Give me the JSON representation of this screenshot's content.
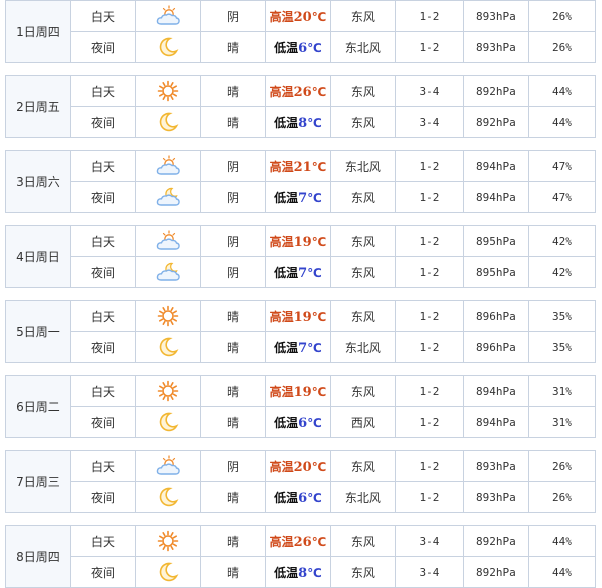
{
  "unit": "℃",
  "icons": {
    "cloudy": "cloudy-sun-icon",
    "sunny": "sun-icon",
    "moon": "crescent-moon-icon",
    "cloudy_night": "cloudy-moon-icon"
  },
  "colors": {
    "high_temp": "#d04a1a",
    "low_temp_number": "#3344cc",
    "border": "#c8d2e0",
    "sun": "#f08a2a",
    "moon": "#f2b733",
    "cloud": "#7fb0e8"
  },
  "days": [
    {
      "date": "1日周四",
      "day": {
        "period": "白天",
        "icon": "cloudy",
        "weather": "阴",
        "temp_label": "高温",
        "temp": "20",
        "wind": "东风",
        "force": "1-2",
        "pressure": "893hPa",
        "humidity": "26%"
      },
      "night": {
        "period": "夜间",
        "icon": "moon",
        "weather": "晴",
        "temp_label": "低温",
        "temp": "6",
        "wind": "东北风",
        "force": "1-2",
        "pressure": "893hPa",
        "humidity": "26%"
      }
    },
    {
      "date": "2日周五",
      "day": {
        "period": "白天",
        "icon": "sunny",
        "weather": "晴",
        "temp_label": "高温",
        "temp": "26",
        "wind": "东风",
        "force": "3-4",
        "pressure": "892hPa",
        "humidity": "44%"
      },
      "night": {
        "period": "夜间",
        "icon": "moon",
        "weather": "晴",
        "temp_label": "低温",
        "temp": "8",
        "wind": "东风",
        "force": "3-4",
        "pressure": "892hPa",
        "humidity": "44%"
      }
    },
    {
      "date": "3日周六",
      "day": {
        "period": "白天",
        "icon": "cloudy",
        "weather": "阴",
        "temp_label": "高温",
        "temp": "21",
        "wind": "东北风",
        "force": "1-2",
        "pressure": "894hPa",
        "humidity": "47%"
      },
      "night": {
        "period": "夜间",
        "icon": "cloudy_night",
        "weather": "阴",
        "temp_label": "低温",
        "temp": "7",
        "wind": "东风",
        "force": "1-2",
        "pressure": "894hPa",
        "humidity": "47%"
      }
    },
    {
      "date": "4日周日",
      "day": {
        "period": "白天",
        "icon": "cloudy",
        "weather": "阴",
        "temp_label": "高温",
        "temp": "19",
        "wind": "东风",
        "force": "1-2",
        "pressure": "895hPa",
        "humidity": "42%"
      },
      "night": {
        "period": "夜间",
        "icon": "cloudy_night",
        "weather": "阴",
        "temp_label": "低温",
        "temp": "7",
        "wind": "东风",
        "force": "1-2",
        "pressure": "895hPa",
        "humidity": "42%"
      }
    },
    {
      "date": "5日周一",
      "day": {
        "period": "白天",
        "icon": "sunny",
        "weather": "晴",
        "temp_label": "高温",
        "temp": "19",
        "wind": "东风",
        "force": "1-2",
        "pressure": "896hPa",
        "humidity": "35%"
      },
      "night": {
        "period": "夜间",
        "icon": "moon",
        "weather": "晴",
        "temp_label": "低温",
        "temp": "7",
        "wind": "东北风",
        "force": "1-2",
        "pressure": "896hPa",
        "humidity": "35%"
      }
    },
    {
      "date": "6日周二",
      "day": {
        "period": "白天",
        "icon": "sunny",
        "weather": "晴",
        "temp_label": "高温",
        "temp": "19",
        "wind": "东风",
        "force": "1-2",
        "pressure": "894hPa",
        "humidity": "31%"
      },
      "night": {
        "period": "夜间",
        "icon": "moon",
        "weather": "晴",
        "temp_label": "低温",
        "temp": "6",
        "wind": "西风",
        "force": "1-2",
        "pressure": "894hPa",
        "humidity": "31%"
      }
    },
    {
      "date": "7日周三",
      "day": {
        "period": "白天",
        "icon": "cloudy",
        "weather": "阴",
        "temp_label": "高温",
        "temp": "20",
        "wind": "东风",
        "force": "1-2",
        "pressure": "893hPa",
        "humidity": "26%"
      },
      "night": {
        "period": "夜间",
        "icon": "moon",
        "weather": "晴",
        "temp_label": "低温",
        "temp": "6",
        "wind": "东北风",
        "force": "1-2",
        "pressure": "893hPa",
        "humidity": "26%"
      }
    },
    {
      "date": "8日周四",
      "day": {
        "period": "白天",
        "icon": "sunny",
        "weather": "晴",
        "temp_label": "高温",
        "temp": "26",
        "wind": "东风",
        "force": "3-4",
        "pressure": "892hPa",
        "humidity": "44%"
      },
      "night": {
        "period": "夜间",
        "icon": "moon",
        "weather": "晴",
        "temp_label": "低温",
        "temp": "8",
        "wind": "东风",
        "force": "3-4",
        "pressure": "892hPa",
        "humidity": "44%"
      }
    }
  ]
}
